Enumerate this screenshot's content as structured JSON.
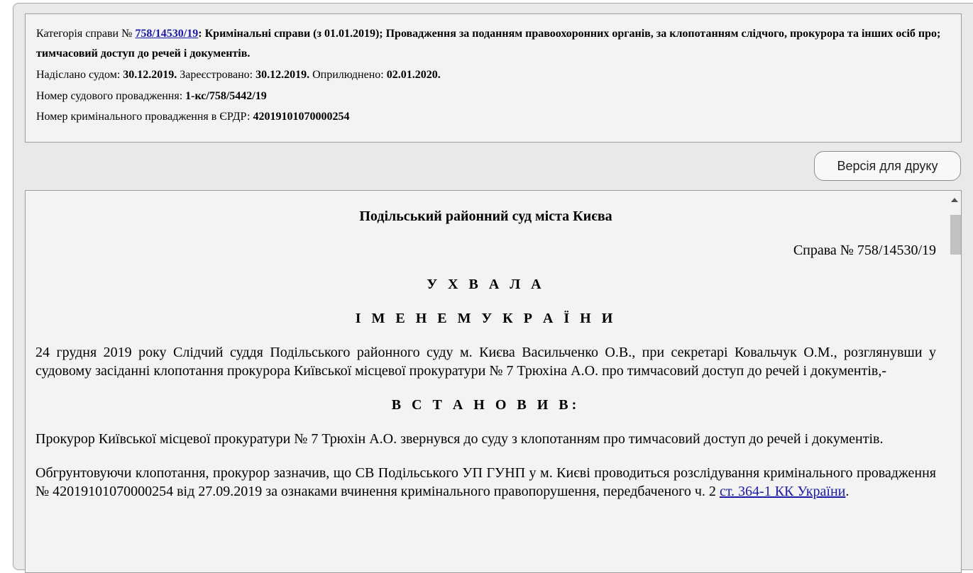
{
  "info": {
    "category_prefix": "Категорія справи № ",
    "category_link": "758/14530/19",
    "category_text": ": Кримінальні справи (з 01.01.2019); Провадження за поданням правоохоронних органів, за клопотанням слідчого, прокурора та інших осіб про; тимчасовий доступ до речей і документів.",
    "sent_label": "Надіслано судом: ",
    "sent_date": "30.12.2019.",
    "registered_label": " Зареєстровано: ",
    "registered_date": "30.12.2019.",
    "published_label": " Оприлюднено: ",
    "published_date": "02.01.2020.",
    "court_case_label": "Номер судового провадження: ",
    "court_case_number": "1-кс/758/5442/19",
    "criminal_case_label": "Номер кримінального провадження в ЄРДР: ",
    "criminal_case_number": "42019101070000254"
  },
  "toolbar": {
    "print_label": "Версія для друку"
  },
  "document": {
    "court_name": "Подільський районний суд міста Києва",
    "case_number": "Справа № 758/14530/19",
    "heading1": "У Х В А Л А",
    "heading2": "І М Е Н Е М У К Р А Ї Н И",
    "paragraph1": "24 грудня 2019 року Слідчий суддя Подільського районного суду м. Києва Васильченко О.В., при секретарі Ковальчук О.М., розглянувши у судовому засіданні клопотання прокурора Київської місцевої прокуратури № 7 Трюхіна А.О. про тимчасовий доступ до речей і документів,-",
    "heading3": "В С Т А Н О В И В:",
    "paragraph2": "Прокурор Київської місцевої прокуратури № 7 Трюхін А.О. звернувся до суду з клопотанням про тимчасовий доступ до речей і документів.",
    "paragraph3_text": "Обгрунтовуючи клопотання, прокурор зазначив, що СВ Подільського УП ГУНП у м. Києві проводиться розслідування кримінального провадження № 42019101070000254 від 27.09.2019 за ознаками вчинення кримінального правопорушення, передбаченого ч. 2 ",
    "paragraph3_link": "ст. 364-1  КК України",
    "paragraph3_end": "."
  }
}
